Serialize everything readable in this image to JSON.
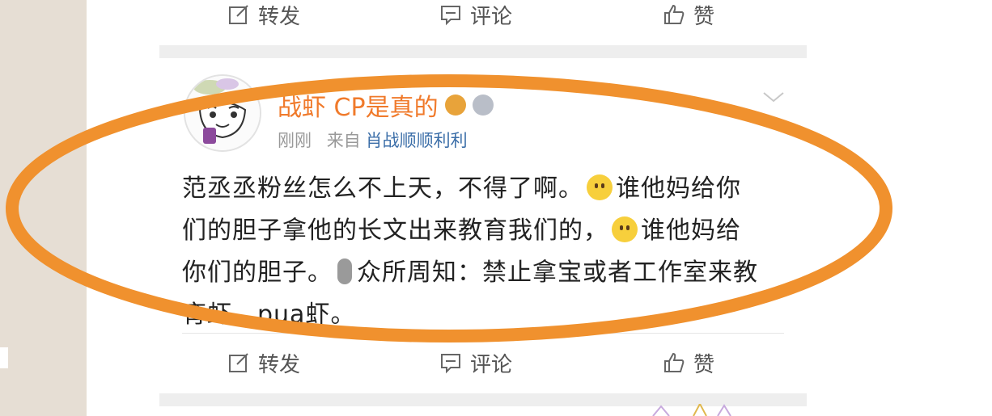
{
  "top_actions": {
    "repost": "转发",
    "comment": "评论",
    "like": "赞"
  },
  "post": {
    "username": "战虾 CP是真的",
    "time": "刚刚",
    "source_prefix": "来自",
    "source": "肖战顺顺利利",
    "text_parts": [
      "范丞丞粉丝怎么不上天，不得了啊。",
      "谁他妈给你们的胆子拿他的长文出来教育我们的，",
      "谁他妈给你们的胆子。",
      "众所周知：禁止拿宝或者工作室来教育虾，pua虾。"
    ]
  },
  "bottom_actions": {
    "repost": "转发",
    "comment": "评论",
    "like": "赞"
  },
  "colors": {
    "accent_orange": "#f07a2b",
    "link_blue": "#3b6ea8",
    "highlight_ring": "#f0912e"
  },
  "icons": [
    "repost-icon",
    "comment-icon",
    "like-icon",
    "crown-icon",
    "medal-icon",
    "chevron-down-icon",
    "smile-emoji-icon",
    "microphone-emoji-icon"
  ]
}
